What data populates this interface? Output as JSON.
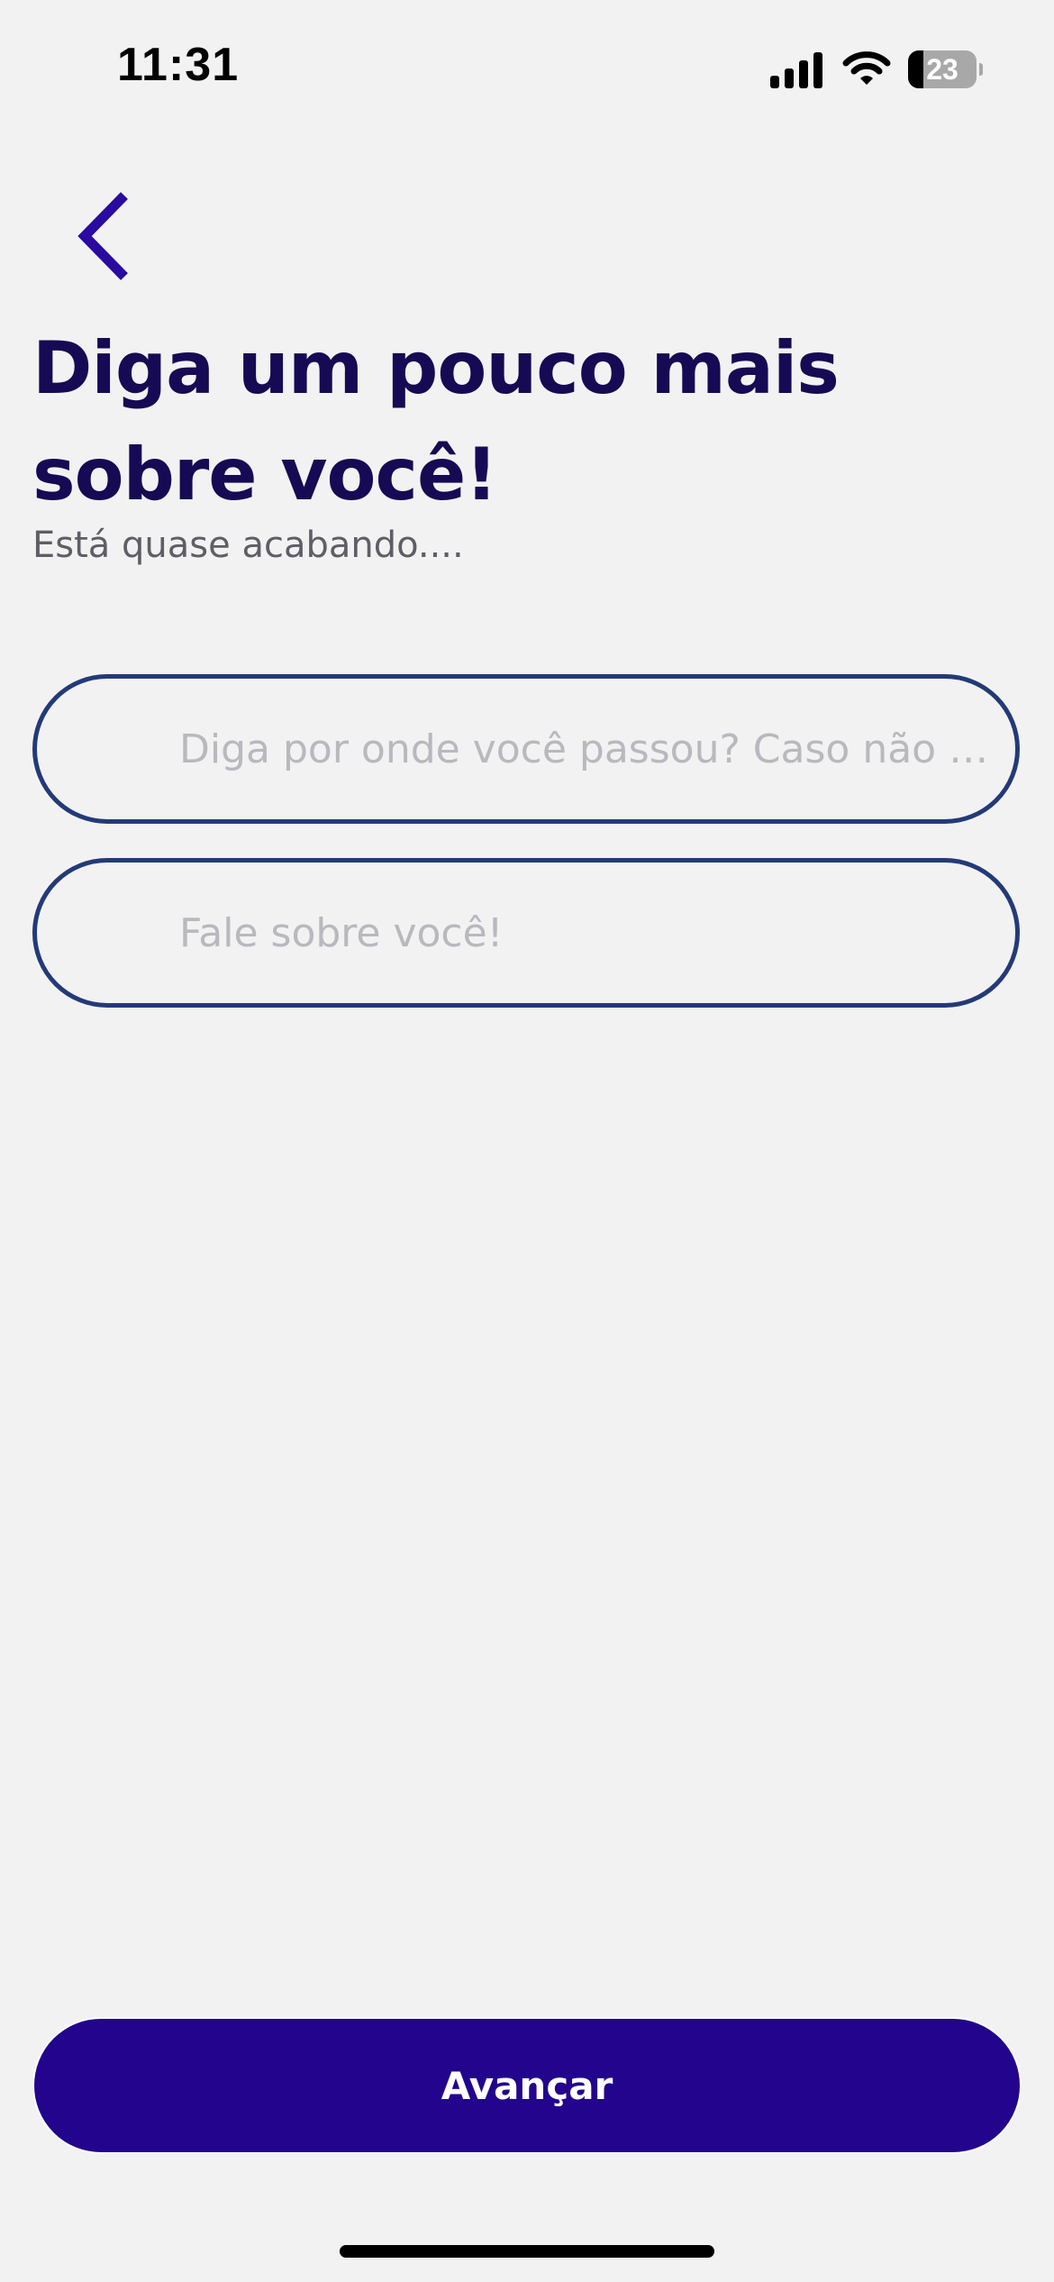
{
  "status_bar": {
    "time": "11:31",
    "battery_level": "23",
    "battery_fraction": 0.23,
    "icons": [
      "signal-icon",
      "wifi-icon",
      "battery-icon"
    ]
  },
  "header": {
    "back_icon": "chevron-left-icon",
    "title": "Diga um pouco mais sobre você!",
    "subtitle": "Está quase acabando...."
  },
  "form": {
    "fields": [
      {
        "placeholder": "Diga por onde você passou? Caso não tenha, basta deixar em branco!",
        "value": ""
      },
      {
        "placeholder": "Fale sobre você!",
        "value": ""
      }
    ]
  },
  "actions": {
    "primary_label": "Avançar"
  },
  "colors": {
    "background": "#f2f2f2",
    "title": "#160a54",
    "accent": "#22058c",
    "back_icon": "#2a0aa0",
    "field_border": "#233a78",
    "placeholder": "#b8b8be"
  }
}
